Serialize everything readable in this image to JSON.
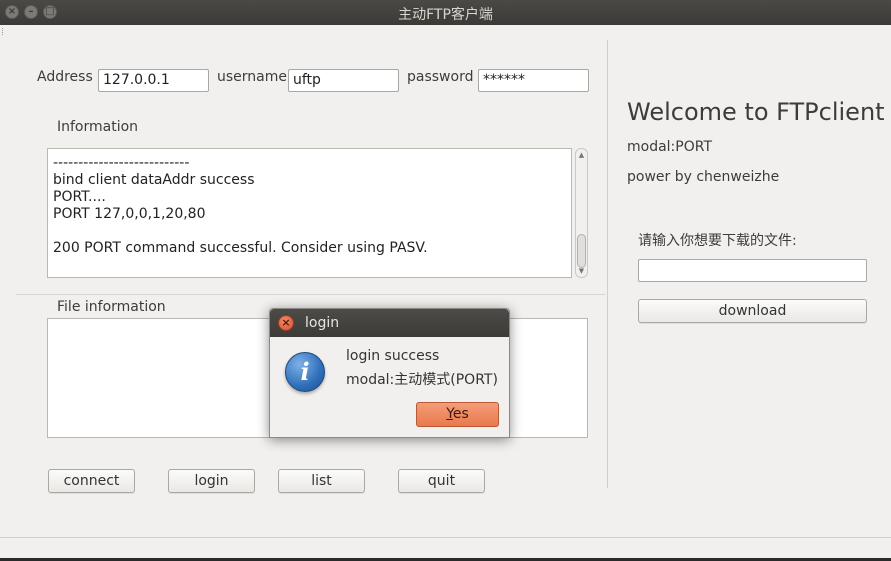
{
  "window": {
    "title": "主动FTP客户端"
  },
  "form": {
    "address_label": "Address",
    "address_value": "127.0.0.1",
    "username_label": "username",
    "username_value": "uftp",
    "password_label": "password",
    "password_value": "******"
  },
  "information": {
    "label": "Information",
    "lines": [
      "---------------------------",
      "bind client dataAddr success",
      "PORT....",
      "PORT 127,0,0,1,20,80",
      "",
      "200 PORT command successful. Consider using PASV."
    ]
  },
  "file_information": {
    "label": "File information"
  },
  "buttons": {
    "connect": "connect",
    "login": "login",
    "list": "list",
    "quit": "quit"
  },
  "side": {
    "welcome": "Welcome to FTPclient",
    "modal": "modal:PORT",
    "power": "power by chenweizhe",
    "download_prompt": "请输入你想要下载的文件:",
    "download_input_value": "",
    "download_button": "download"
  },
  "dialog": {
    "title": "login",
    "message_line1": "login success",
    "message_line2": "modal:主动模式(PORT)",
    "yes_mnemonic": "Y",
    "yes_rest": "es"
  },
  "icons": {
    "close": "close-icon",
    "minimize": "minimize-icon",
    "maximize": "maximize-icon",
    "info": "info-icon"
  }
}
